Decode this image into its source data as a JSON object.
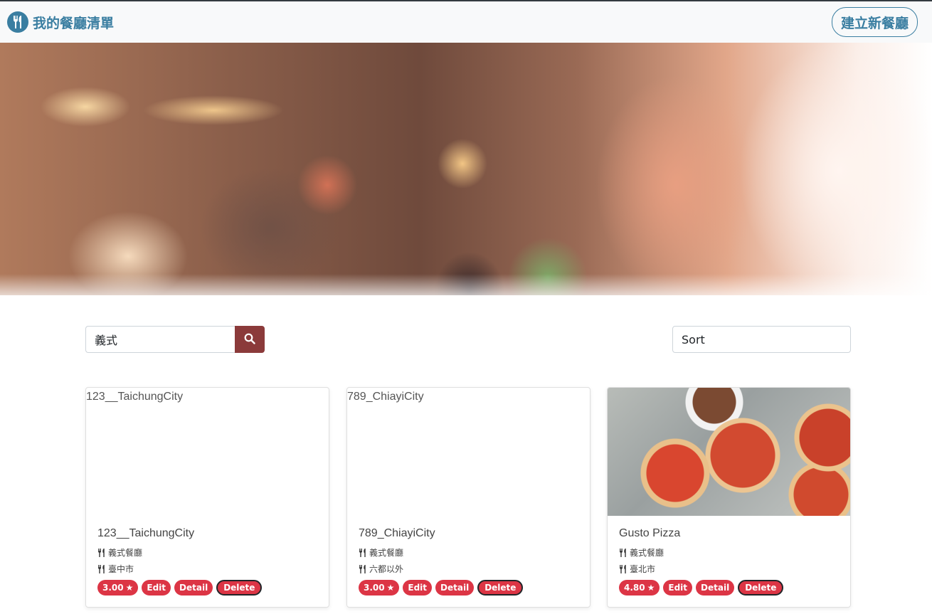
{
  "navbar": {
    "brand_label": "我的餐廳清單",
    "brand_icon": "utensils-icon",
    "create_label": "建立新餐廳"
  },
  "search": {
    "value": "義式",
    "button_icon": "search-icon"
  },
  "sort": {
    "selected": "Sort"
  },
  "colors": {
    "brand": "#3a7ea1",
    "search_button": "#8b3a3a",
    "badge": "#dc3545"
  },
  "restaurants": [
    {
      "image_alt": "123__TaichungCity",
      "name": "123__TaichungCity",
      "category": "義式餐廳",
      "location": "臺中市",
      "rating": "3.00",
      "edit_label": "Edit",
      "detail_label": "Detail",
      "delete_label": "Delete"
    },
    {
      "image_alt": "789_ChiayiCity",
      "name": "789_ChiayiCity",
      "category": "義式餐廳",
      "location": "六都以外",
      "rating": "3.00",
      "edit_label": "Edit",
      "detail_label": "Detail",
      "delete_label": "Delete"
    },
    {
      "image_alt": "",
      "name": "Gusto Pizza",
      "category": "義式餐廳",
      "location": "臺北市",
      "rating": "4.80",
      "edit_label": "Edit",
      "detail_label": "Detail",
      "delete_label": "Delete"
    }
  ]
}
